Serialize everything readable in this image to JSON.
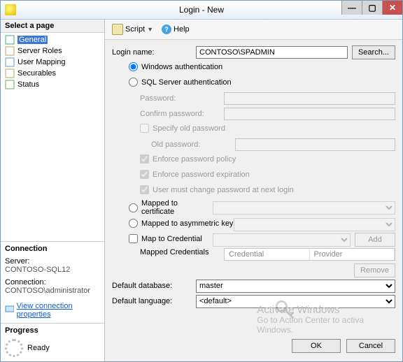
{
  "window": {
    "title": "Login - New"
  },
  "toolbar": {
    "script": "Script",
    "help": "Help"
  },
  "sidebar": {
    "select_page": "Select a page",
    "items": [
      {
        "label": "General",
        "selected": true
      },
      {
        "label": "Server Roles",
        "selected": false
      },
      {
        "label": "User Mapping",
        "selected": false
      },
      {
        "label": "Securables",
        "selected": false
      },
      {
        "label": "Status",
        "selected": false
      }
    ],
    "connection": {
      "header": "Connection",
      "server_lbl": "Server:",
      "server_val": "CONTOSO-SQL12",
      "conn_lbl": "Connection:",
      "conn_val": "CONTOSO\\administrator",
      "view_link": "View connection properties"
    },
    "progress": {
      "header": "Progress",
      "status": "Ready"
    }
  },
  "form": {
    "login_name_lbl": "Login name:",
    "login_name_val": "CONTOSO\\SPADMIN",
    "search_btn": "Search...",
    "win_auth": "Windows authentication",
    "sql_auth": "SQL Server authentication",
    "password_lbl": "Password:",
    "confirm_lbl": "Confirm password:",
    "specify_old": "Specify old password",
    "old_pw_lbl": "Old password:",
    "enforce_policy": "Enforce password policy",
    "enforce_exp": "Enforce password expiration",
    "must_change": "User must change password at next login",
    "mapped_cert": "Mapped to certificate",
    "mapped_asym": "Mapped to asymmetric key",
    "map_cred": "Map to Credential",
    "mapped_creds_lbl": "Mapped Credentials",
    "cred_col1": "Credential",
    "cred_col2": "Provider",
    "add_btn": "Add",
    "remove_btn": "Remove",
    "def_db_lbl": "Default database:",
    "def_db_val": "master",
    "def_lang_lbl": "Default language:",
    "def_lang_val": "<default>"
  },
  "buttons": {
    "ok": "OK",
    "cancel": "Cancel"
  },
  "watermark": {
    "l1": "Activate Windows",
    "l2": "Go to Action Center to activa",
    "l3": "Windows."
  }
}
